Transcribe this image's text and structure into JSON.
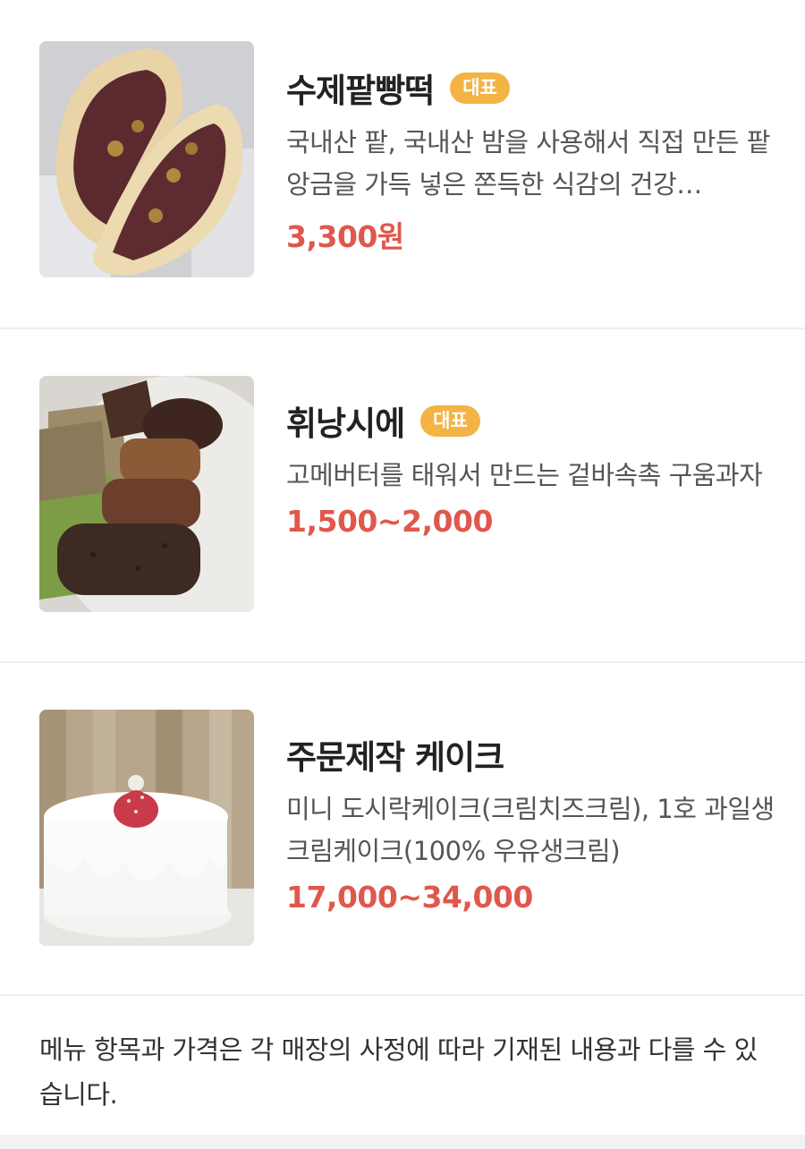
{
  "menu": {
    "items": [
      {
        "name": "수제팥빵떡",
        "badge": "대표",
        "description": "국내산 팥, 국내산 밤을 사용해서 직접 만든 팥앙금을 가득 넣은 쫀득한 식감의 건강…",
        "price": "3,300원",
        "image": "red-bean-bread-photo"
      },
      {
        "name": "휘낭시에",
        "badge": "대표",
        "description": "고메버터를 태워서 만드는 겉바속촉 구움과자",
        "price": "1,500~2,000",
        "image": "financier-photo"
      },
      {
        "name": "주문제작 케이크",
        "badge": "",
        "description": "미니 도시락케이크(크림치즈크림), 1호 과일생크림케이크(100% 우유생크림)",
        "price": "17,000~34,000",
        "image": "custom-cake-photo"
      }
    ],
    "notice": "메뉴 항목과 가격은 각 매장의 사정에 따라 기재된 내용과 다를 수 있습니다."
  },
  "colors": {
    "price": "#e0574c",
    "badge": "#f3b345",
    "divider": "#eeeeee"
  }
}
